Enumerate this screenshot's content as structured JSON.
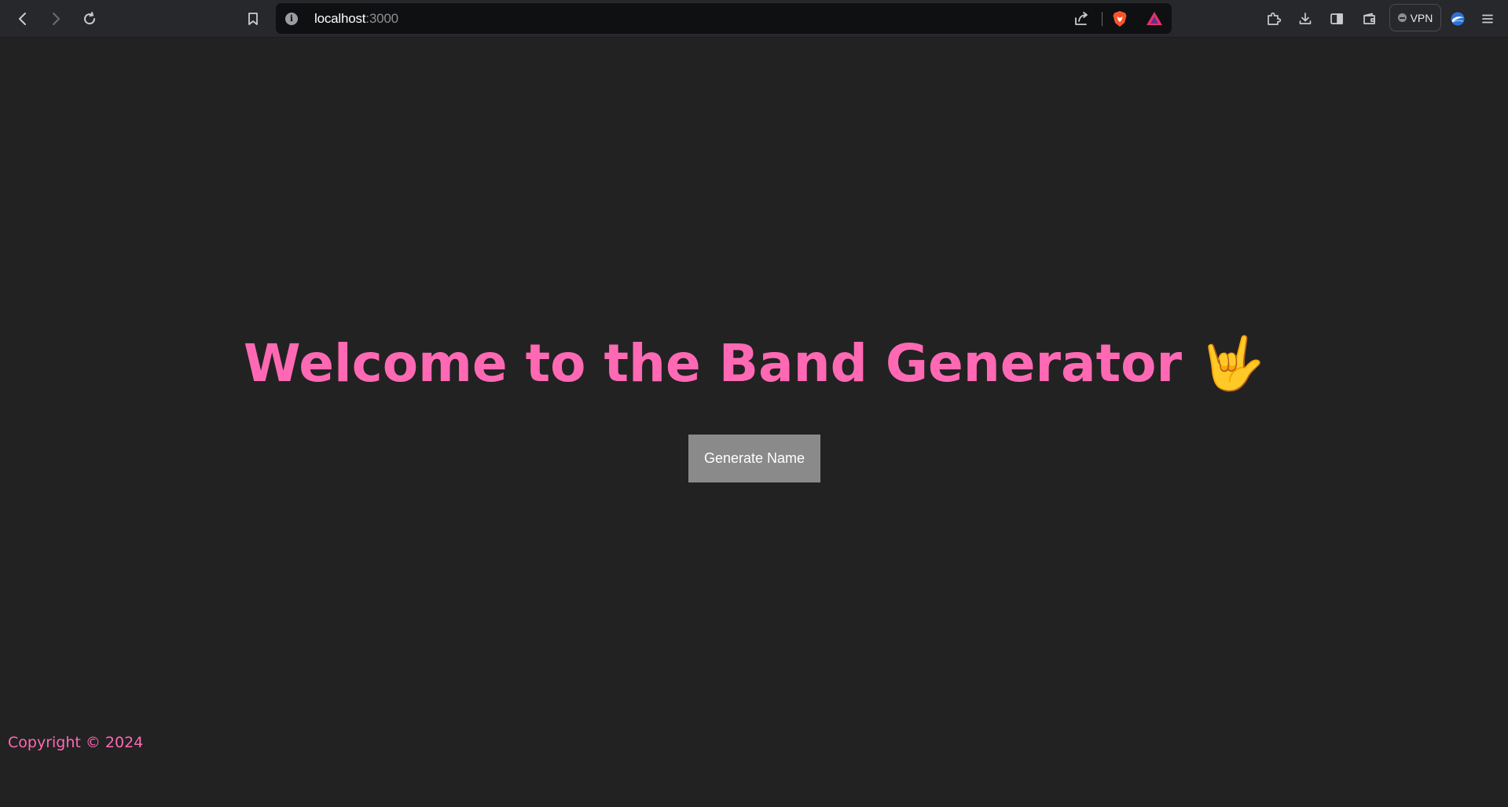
{
  "browser": {
    "url_host": "localhost",
    "url_port": ":3000",
    "vpn_label": "VPN"
  },
  "page": {
    "headline": "Welcome to the Band Generator 🤟",
    "generate_button_label": "Generate Name",
    "footer_text": "Copyright © 2024"
  },
  "colors": {
    "accent": "#ff69b4",
    "background": "#222222",
    "button": "#8a8a8a"
  }
}
